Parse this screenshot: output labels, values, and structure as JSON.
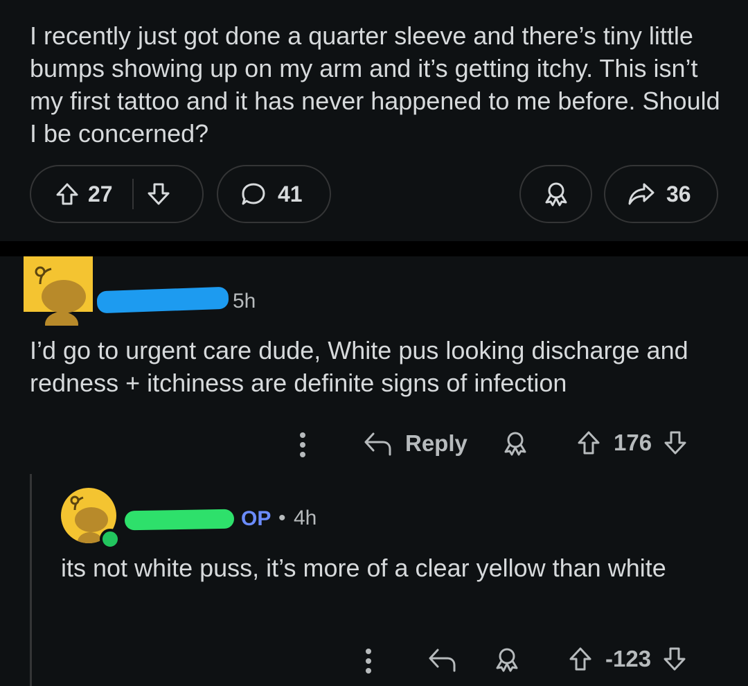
{
  "post": {
    "body": "I recently just got done a quarter sleeve and there’s tiny little bumps showing up on my arm and it’s getting itchy. This isn’t my first tattoo and it has never happened to me before. Should I be concerned?",
    "upvotes": "27",
    "comments": "41",
    "shares": "36"
  },
  "comment1": {
    "time": "5h",
    "text": "I’d go to urgent care dude, White pus looking discharge and redness + itchiness are definite signs of infection",
    "reply_label": "Reply",
    "score": "176"
  },
  "comment2": {
    "op_badge": "OP",
    "separator": "•",
    "time": "4h",
    "text": "its not white puss, it’s more of a clear yellow than white",
    "score": "-123"
  },
  "colors": {
    "background": "#0e1113",
    "avatar_yellow": "#f4c431",
    "redact_blue": "#1d9bf0",
    "redact_green": "#2ee06b",
    "op_blue": "#6b8cff",
    "online_green": "#22c55e"
  },
  "icons": [
    "upvote-icon",
    "downvote-icon",
    "comment-icon",
    "award-icon",
    "share-icon",
    "reply-icon",
    "more-icon"
  ]
}
